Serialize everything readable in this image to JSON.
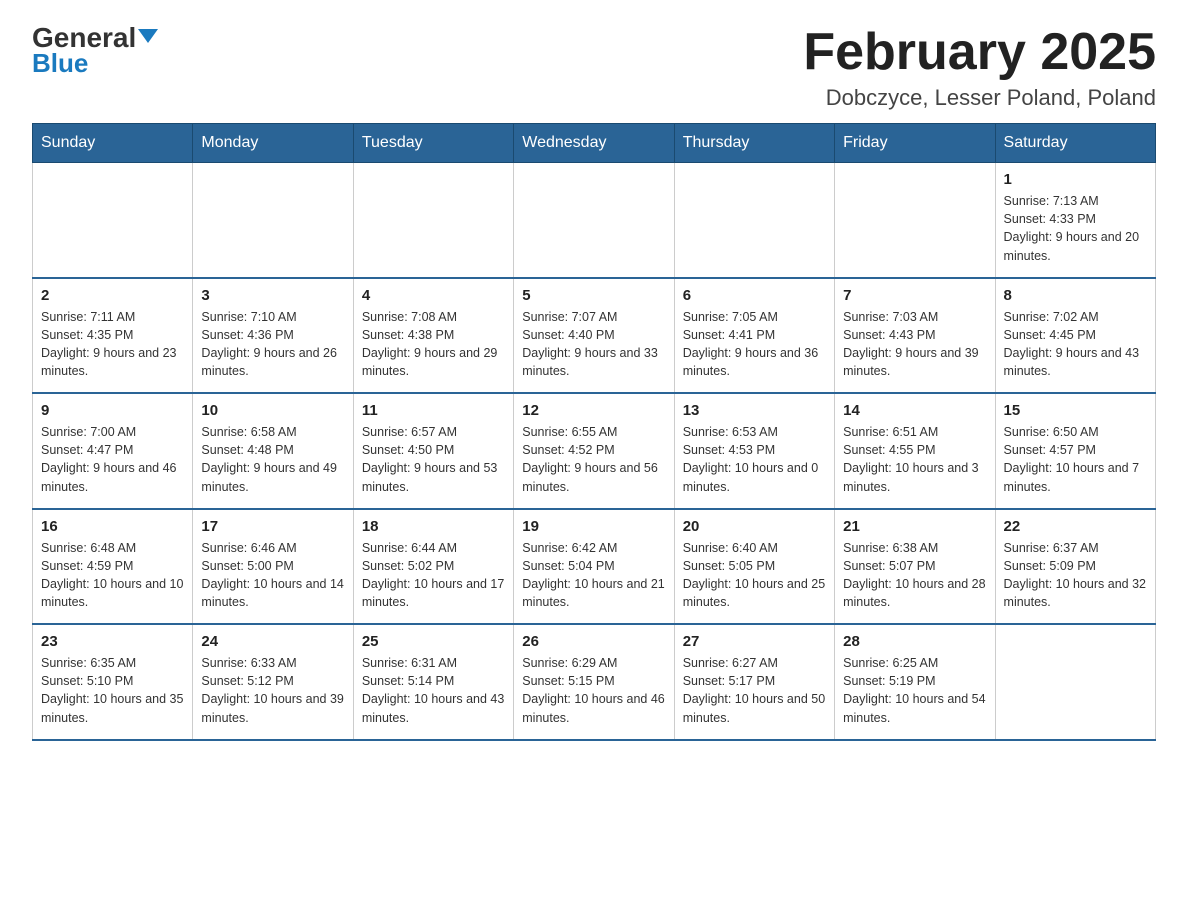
{
  "logo": {
    "general": "General",
    "blue": "Blue"
  },
  "title": "February 2025",
  "subtitle": "Dobczyce, Lesser Poland, Poland",
  "days_of_week": [
    "Sunday",
    "Monday",
    "Tuesday",
    "Wednesday",
    "Thursday",
    "Friday",
    "Saturday"
  ],
  "weeks": [
    [
      {
        "day": "",
        "info": ""
      },
      {
        "day": "",
        "info": ""
      },
      {
        "day": "",
        "info": ""
      },
      {
        "day": "",
        "info": ""
      },
      {
        "day": "",
        "info": ""
      },
      {
        "day": "",
        "info": ""
      },
      {
        "day": "1",
        "info": "Sunrise: 7:13 AM\nSunset: 4:33 PM\nDaylight: 9 hours and 20 minutes."
      }
    ],
    [
      {
        "day": "2",
        "info": "Sunrise: 7:11 AM\nSunset: 4:35 PM\nDaylight: 9 hours and 23 minutes."
      },
      {
        "day": "3",
        "info": "Sunrise: 7:10 AM\nSunset: 4:36 PM\nDaylight: 9 hours and 26 minutes."
      },
      {
        "day": "4",
        "info": "Sunrise: 7:08 AM\nSunset: 4:38 PM\nDaylight: 9 hours and 29 minutes."
      },
      {
        "day": "5",
        "info": "Sunrise: 7:07 AM\nSunset: 4:40 PM\nDaylight: 9 hours and 33 minutes."
      },
      {
        "day": "6",
        "info": "Sunrise: 7:05 AM\nSunset: 4:41 PM\nDaylight: 9 hours and 36 minutes."
      },
      {
        "day": "7",
        "info": "Sunrise: 7:03 AM\nSunset: 4:43 PM\nDaylight: 9 hours and 39 minutes."
      },
      {
        "day": "8",
        "info": "Sunrise: 7:02 AM\nSunset: 4:45 PM\nDaylight: 9 hours and 43 minutes."
      }
    ],
    [
      {
        "day": "9",
        "info": "Sunrise: 7:00 AM\nSunset: 4:47 PM\nDaylight: 9 hours and 46 minutes."
      },
      {
        "day": "10",
        "info": "Sunrise: 6:58 AM\nSunset: 4:48 PM\nDaylight: 9 hours and 49 minutes."
      },
      {
        "day": "11",
        "info": "Sunrise: 6:57 AM\nSunset: 4:50 PM\nDaylight: 9 hours and 53 minutes."
      },
      {
        "day": "12",
        "info": "Sunrise: 6:55 AM\nSunset: 4:52 PM\nDaylight: 9 hours and 56 minutes."
      },
      {
        "day": "13",
        "info": "Sunrise: 6:53 AM\nSunset: 4:53 PM\nDaylight: 10 hours and 0 minutes."
      },
      {
        "day": "14",
        "info": "Sunrise: 6:51 AM\nSunset: 4:55 PM\nDaylight: 10 hours and 3 minutes."
      },
      {
        "day": "15",
        "info": "Sunrise: 6:50 AM\nSunset: 4:57 PM\nDaylight: 10 hours and 7 minutes."
      }
    ],
    [
      {
        "day": "16",
        "info": "Sunrise: 6:48 AM\nSunset: 4:59 PM\nDaylight: 10 hours and 10 minutes."
      },
      {
        "day": "17",
        "info": "Sunrise: 6:46 AM\nSunset: 5:00 PM\nDaylight: 10 hours and 14 minutes."
      },
      {
        "day": "18",
        "info": "Sunrise: 6:44 AM\nSunset: 5:02 PM\nDaylight: 10 hours and 17 minutes."
      },
      {
        "day": "19",
        "info": "Sunrise: 6:42 AM\nSunset: 5:04 PM\nDaylight: 10 hours and 21 minutes."
      },
      {
        "day": "20",
        "info": "Sunrise: 6:40 AM\nSunset: 5:05 PM\nDaylight: 10 hours and 25 minutes."
      },
      {
        "day": "21",
        "info": "Sunrise: 6:38 AM\nSunset: 5:07 PM\nDaylight: 10 hours and 28 minutes."
      },
      {
        "day": "22",
        "info": "Sunrise: 6:37 AM\nSunset: 5:09 PM\nDaylight: 10 hours and 32 minutes."
      }
    ],
    [
      {
        "day": "23",
        "info": "Sunrise: 6:35 AM\nSunset: 5:10 PM\nDaylight: 10 hours and 35 minutes."
      },
      {
        "day": "24",
        "info": "Sunrise: 6:33 AM\nSunset: 5:12 PM\nDaylight: 10 hours and 39 minutes."
      },
      {
        "day": "25",
        "info": "Sunrise: 6:31 AM\nSunset: 5:14 PM\nDaylight: 10 hours and 43 minutes."
      },
      {
        "day": "26",
        "info": "Sunrise: 6:29 AM\nSunset: 5:15 PM\nDaylight: 10 hours and 46 minutes."
      },
      {
        "day": "27",
        "info": "Sunrise: 6:27 AM\nSunset: 5:17 PM\nDaylight: 10 hours and 50 minutes."
      },
      {
        "day": "28",
        "info": "Sunrise: 6:25 AM\nSunset: 5:19 PM\nDaylight: 10 hours and 54 minutes."
      },
      {
        "day": "",
        "info": ""
      }
    ]
  ]
}
